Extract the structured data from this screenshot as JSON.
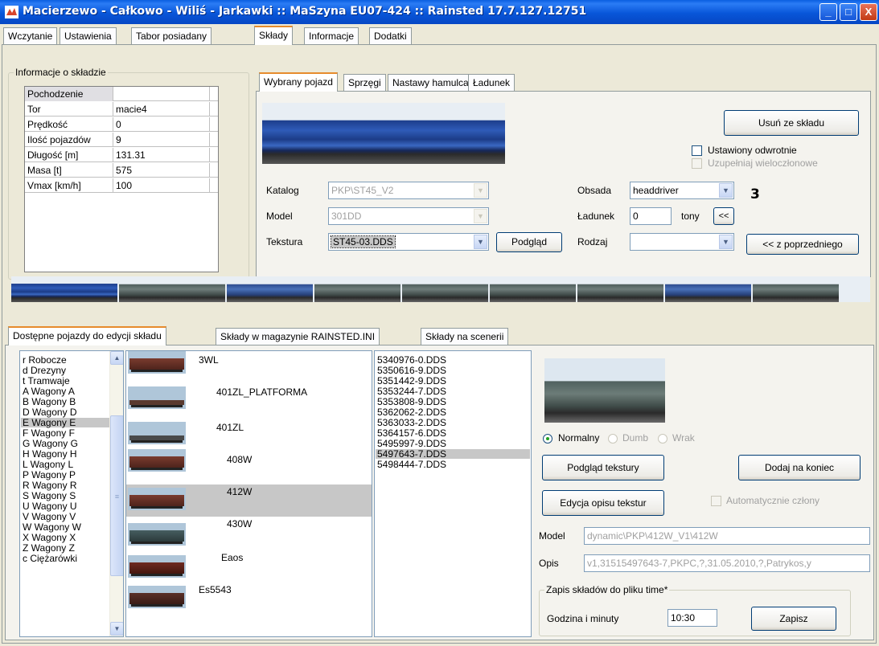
{
  "window": {
    "title": "Macierzewo - Całkowo - Wiliś - Jarkawki :: MaSzyna EU07-424 :: Rainsted 17.7.127.12751",
    "minimize_label": "_",
    "maximize_label": "□",
    "close_label": "X"
  },
  "main_tabs": [
    "Wczytanie",
    "Ustawienia",
    "Tabor posiadany",
    "Składy",
    "Informacje",
    "Dodatki"
  ],
  "info_group": {
    "legend": "Informacje o składzie",
    "rows": [
      {
        "label": "Pochodzenie",
        "value": ""
      },
      {
        "label": "Tor",
        "value": "macie4"
      },
      {
        "label": "Prędkość",
        "value": "0"
      },
      {
        "label": "Ilość pojazdów",
        "value": "9"
      },
      {
        "label": "Długość [m]",
        "value": "131.31"
      },
      {
        "label": "Masa [t]",
        "value": "575"
      },
      {
        "label": "Vmax [km/h]",
        "value": "100"
      }
    ]
  },
  "vehicle_tabs": [
    "Wybrany pojazd",
    "Sprzęgi",
    "Nastawy hamulca",
    "Ładunek"
  ],
  "vehicle": {
    "remove_button": "Usuń ze składu",
    "reversed_label": "Ustawiony odwrotnie",
    "multipart_label": "Uzupełniaj wieloczłonowe",
    "catalog_label": "Katalog",
    "catalog_value": "PKP\\ST45_V2",
    "model_label": "Model",
    "model_value": "301DD",
    "texture_label": "Tekstura",
    "texture_value": "ST45-03.DDS",
    "preview_button": "Podgląd",
    "crew_label": "Obsada",
    "crew_value": "headdriver",
    "crew_count": "3",
    "load_label": "Ładunek",
    "load_value": "0",
    "load_unit": "tony",
    "load_button": "<<",
    "type_label": "Rodzaj",
    "type_value": "",
    "from_previous_button": "<< z poprzedniego"
  },
  "bottom_tabs": [
    "Dostępne pojazdy do edycji składu",
    "Składy w magazynie RAINSTED.INI",
    "Składy na scenerii"
  ],
  "categories": [
    "r Robocze",
    "d Drezyny",
    "t Tramwaje",
    "A Wagony A",
    "B Wagony B",
    "D Wagony D",
    "E Wagony E",
    "F Wagony F",
    "G Wagony G",
    "H Wagony H",
    "L Wagony L",
    "P Wagony P",
    "R Wagony R",
    "S Wagony S",
    "U Wagony U",
    "V Wagony V",
    "W Wagony W",
    "X Wagony X",
    "Z Wagony Z",
    "c Ciężarówki"
  ],
  "selected_category": "E Wagony E",
  "wagons": [
    "3WL",
    "401ZL_PLATFORMA",
    "401ZL",
    "408W",
    "412W",
    "430W",
    "Eaos",
    "Es5543"
  ],
  "selected_wagon": "412W",
  "textures": [
    "5340976-0.DDS",
    "5350616-9.DDS",
    "5351442-9.DDS",
    "5353244-7.DDS",
    "5353808-9.DDS",
    "5362062-2.DDS",
    "5363033-2.DDS",
    "5364157-6.DDS",
    "5495997-9.DDS",
    "5497643-7.DDS",
    "5498444-7.DDS"
  ],
  "selected_texture": "5497643-7.DDS",
  "detail": {
    "radio_normal": "Normalny",
    "radio_dumb": "Dumb",
    "radio_wreck": "Wrak",
    "texture_preview_button": "Podgląd tekstury",
    "add_to_end_button": "Dodaj na koniec",
    "edit_descriptions_button": "Edycja opisu tekstur",
    "auto_parts_label": "Automatycznie człony",
    "model_label": "Model",
    "model_value": "dynamic\\PKP\\412W_V1\\412W",
    "desc_label": "Opis",
    "desc_value": "v1,31515497643-7,PKPC,?,31.05.2010,?,Patrykos,y",
    "save_group_legend": "Zapis składów do pliku time*",
    "time_label": "Godzina i minuty",
    "time_value": "10:30",
    "save_button": "Zapisz"
  }
}
